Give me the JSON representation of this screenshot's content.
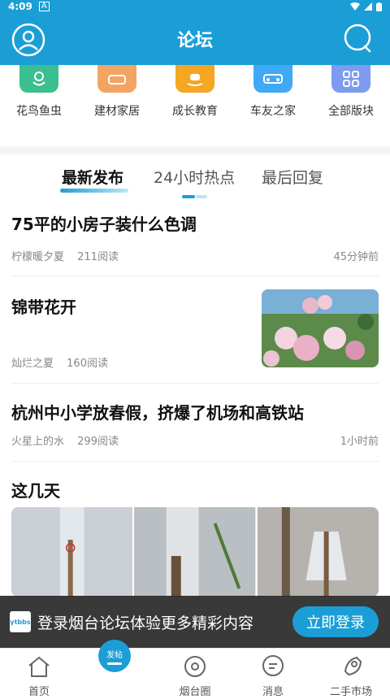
{
  "status": {
    "time": "4:09",
    "a_badge": "A"
  },
  "header": {
    "title": "论坛",
    "avatar_icon": "user-circle-icon",
    "search_icon": "search-icon"
  },
  "categories": [
    {
      "label": "花鸟鱼虫",
      "color": "#3bbf8f",
      "icon": "flower-icon"
    },
    {
      "label": "建材家居",
      "color": "#f2a562",
      "icon": "sofa-icon"
    },
    {
      "label": "成长教育",
      "color": "#f5a623",
      "icon": "rocking-horse-icon"
    },
    {
      "label": "车友之家",
      "color": "#3fa9f5",
      "icon": "car-icon"
    },
    {
      "label": "全部版块",
      "color": "#7d9cf0",
      "icon": "grid-icon"
    }
  ],
  "tabs": [
    "最新发布",
    "24小时热点",
    "最后回复"
  ],
  "posts": [
    {
      "title": "75平的小房子装什么色调",
      "author": "柠檬暖夕夏",
      "views": "211阅读",
      "time": "45分钟前"
    },
    {
      "title": "锦带花开",
      "author": "灿烂之夏",
      "views": "160阅读"
    },
    {
      "title": "杭州中小学放春假，挤爆了机场和高铁站",
      "author": "火星上的水",
      "views": "299阅读",
      "time": "1小时前"
    },
    {
      "title": "这几天"
    }
  ],
  "banner": {
    "logo": "ytbbs",
    "text": "登录烟台论坛体验更多精彩内容",
    "button": "立即登录"
  },
  "fab": {
    "label": "发帖"
  },
  "nav": [
    {
      "label": "首页",
      "icon": "home-icon"
    },
    {
      "label": "烟台圈",
      "icon": "circle-eye-icon"
    },
    {
      "label": "消息",
      "icon": "message-icon"
    },
    {
      "label": "二手市场",
      "icon": "rocket-icon"
    }
  ],
  "colors": {
    "accent": "#1b9ed6"
  }
}
